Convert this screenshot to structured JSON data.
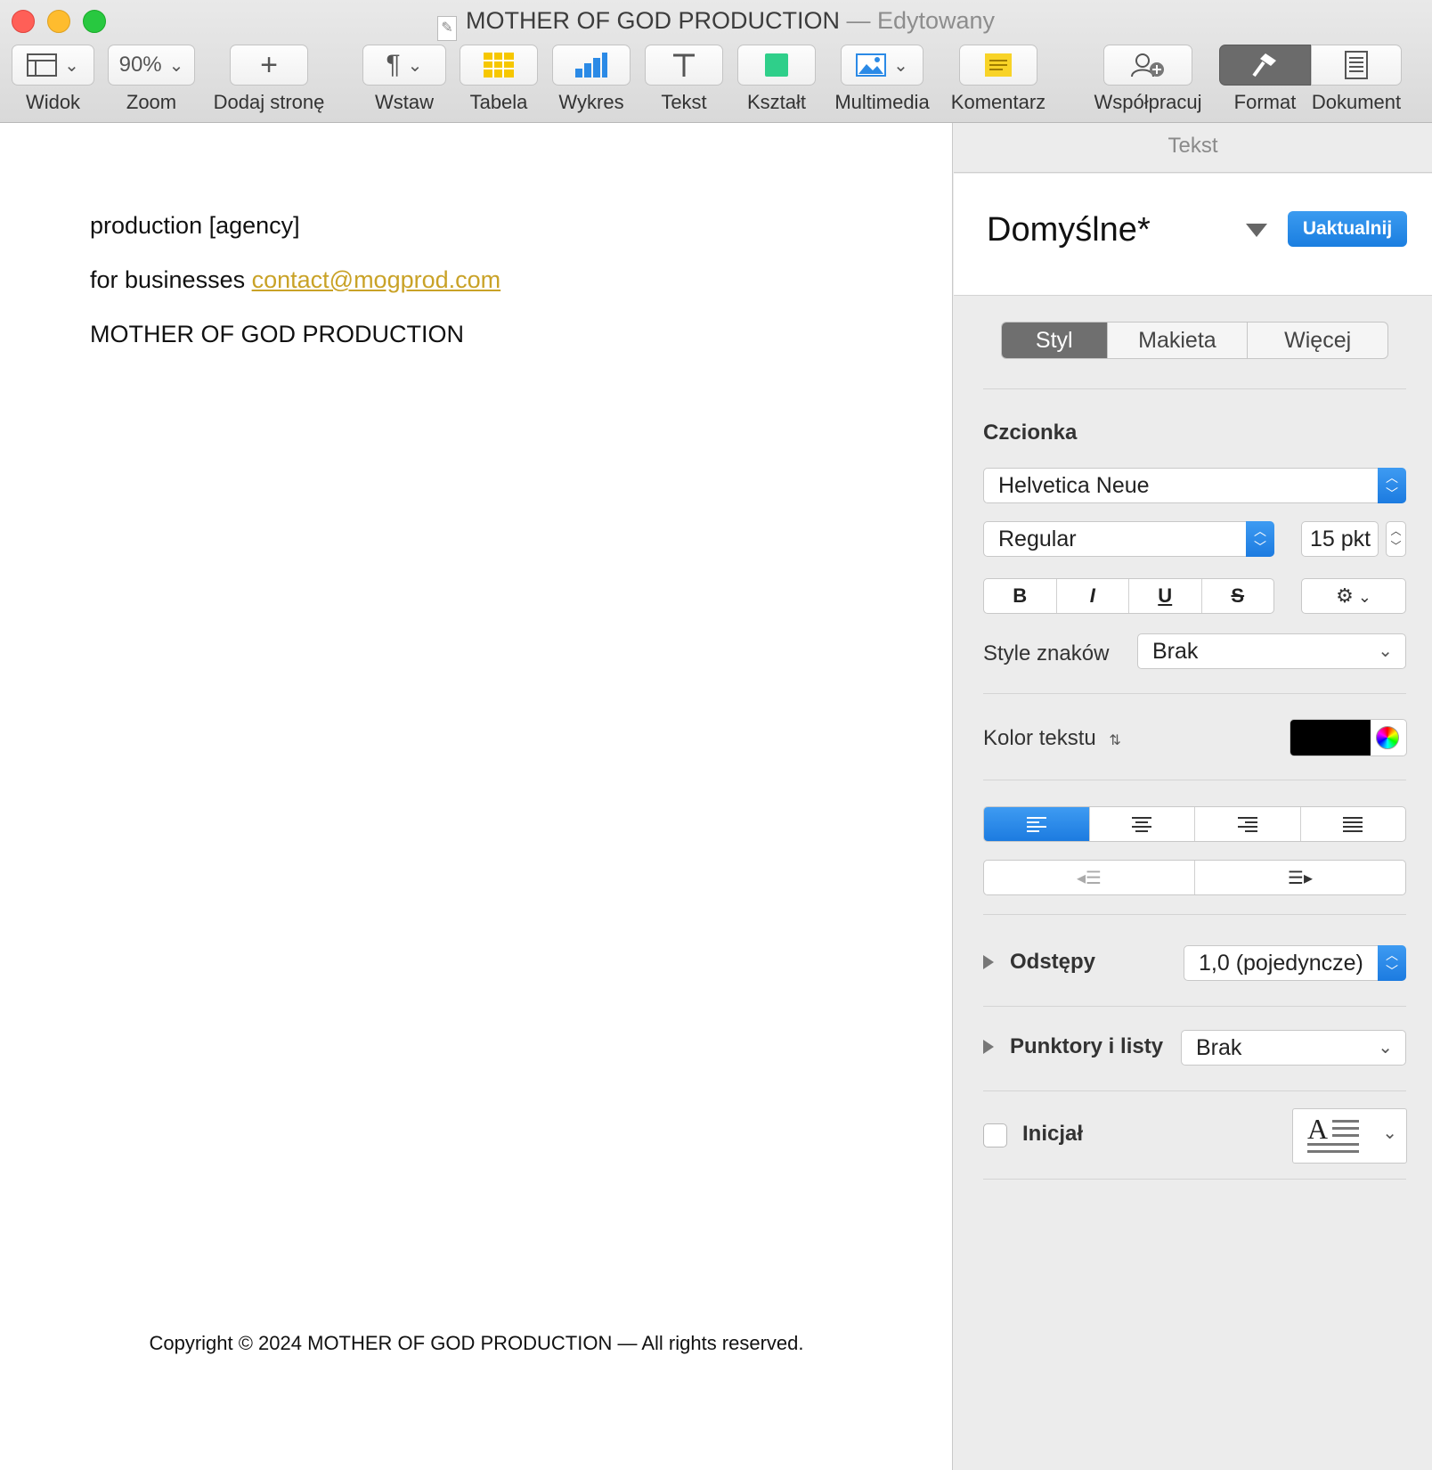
{
  "window": {
    "title": "MOTHER OF GOD PRODUCTION",
    "edited_suffix": "— Edytowany"
  },
  "toolbar": {
    "view": "Widok",
    "zoom_value": "90%",
    "zoom": "Zoom",
    "add_page": "Dodaj stronę",
    "insert": "Wstaw",
    "table": "Tabela",
    "chart": "Wykres",
    "text": "Tekst",
    "shape": "Kształt",
    "media": "Multimedia",
    "comment": "Komentarz",
    "collaborate": "Współpracuj",
    "format": "Format",
    "document": "Dokument"
  },
  "document": {
    "line1": "production [agency]",
    "line2_prefix": "for businesses",
    "line2_email": "contact@mogprod.com",
    "line3": "MOTHER OF GOD PRODUCTION",
    "footer": "Copyright © 2024 MOTHER OF GOD PRODUCTION — All rights reserved."
  },
  "inspector": {
    "header": "Tekst",
    "paragraph_style": "Domyślne*",
    "update_button": "Uaktualnij",
    "tabs": [
      "Styl",
      "Makieta",
      "Więcej"
    ],
    "font_section": "Czcionka",
    "font_family": "Helvetica Neue",
    "font_weight": "Regular",
    "font_size": "15 pkt",
    "bold": "B",
    "italic": "I",
    "underline": "U",
    "strike": "S",
    "char_styles_label": "Style znaków",
    "char_styles_value": "Brak",
    "text_color_label": "Kolor tekstu",
    "text_color": "#000000",
    "spacing_label": "Odstępy",
    "spacing_value": "1,0 (pojedyncze)",
    "bullets_label": "Punktory i listy",
    "bullets_value": "Brak",
    "dropcap_label": "Inicjał",
    "dropcap_glyph": "A"
  }
}
